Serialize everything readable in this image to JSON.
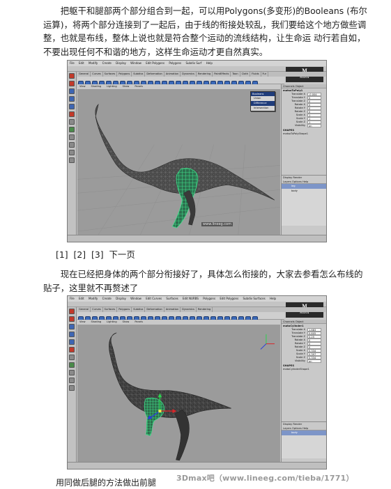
{
  "paragraph1": "把躯干和腿部两个部分组合到一起，可以用Polygons(多变形)的Booleans (布尔运算)，将两个部分连接到了一起后，由于线的衔接处较乱，我们要给这个地方做些调整，也就是布线，整体上说也就是符合整个运动的流线结构，让生命运 动行若自如，不要出现任何不和谐的地方，这样生命运动才更自然真实。",
  "pager": {
    "p1": "[1]",
    "p2": "[2]",
    "p3": "[3]",
    "next": "下一页"
  },
  "paragraph2": "现在已经把身体的两个部分衔接好了，具体怎么衔接的，大家去参看怎么布线的贴子，这里就不再赘述了",
  "caption": "用同做后腿的方法做出前腿",
  "watermark": "3Dmax吧（www.lineeg.com/tieba/1771）",
  "maya1": {
    "menubar": [
      "File",
      "Edit",
      "Modify",
      "Create",
      "Display",
      "Window",
      "Edit Polygons",
      "Polygons",
      "Subdiv Surf",
      "Help"
    ],
    "shelf_tabs": [
      "General",
      "Curves",
      "Surfaces",
      "Polygons",
      "Subdivs",
      "Deformation",
      "Animation",
      "Dynamics",
      "Rendering",
      "PaintEffects",
      "Toon",
      "Cloth",
      "Fluids",
      "Fur"
    ],
    "panel_menu": [
      "View",
      "Shading",
      "Lighting",
      "Show",
      "Panels"
    ],
    "boolean_menu": {
      "title": "Booleans",
      "options": [
        "Union",
        "Difference",
        "Intersection"
      ]
    },
    "channel": {
      "tabs": "Channels  Object",
      "object": "matsoTuPoly1",
      "rows": [
        {
          "label": "Translate X",
          "value": "-0.004"
        },
        {
          "label": "Translate Y",
          "value": "0"
        },
        {
          "label": "Translate Z",
          "value": "0"
        },
        {
          "label": "Rotate X",
          "value": "0"
        },
        {
          "label": "Rotate Y",
          "value": "0"
        },
        {
          "label": "Rotate Z",
          "value": "0"
        },
        {
          "label": "Scale X",
          "value": "1"
        },
        {
          "label": "Scale Y",
          "value": "1"
        },
        {
          "label": "Scale Z",
          "value": "1"
        },
        {
          "label": "Visibility",
          "value": "on"
        }
      ],
      "shapes_title": "SHAPES",
      "shape": "matsoTuPolyShape1"
    },
    "layers": {
      "tabs": "Display  Render",
      "menu": "Layers  Options  Help",
      "items": [
        "leg",
        "body"
      ]
    },
    "viewport_watermark": "www.lineeg.com"
  },
  "maya2": {
    "menubar": [
      "File",
      "Edit",
      "Modify",
      "Create",
      "Display",
      "Window",
      "Edit Curves",
      "Surfaces",
      "Edit NURBS",
      "Polygons",
      "Edit Polygons",
      "Subdiv Surfaces",
      "Help"
    ],
    "shelf_tabs": [
      "General",
      "Curves",
      "Surfaces",
      "Polygons",
      "Subdivs",
      "Deformation",
      "Animation",
      "Dynamics",
      "Rendering"
    ],
    "panel_menu": [
      "View",
      "Shading",
      "Lighting",
      "Show",
      "Panels"
    ],
    "channel": {
      "tabs": "Channels  Object",
      "object": "matoCylinder1",
      "rows": [
        {
          "label": "Translate X",
          "value": "1.683"
        },
        {
          "label": "Translate Y",
          "value": "0.605"
        },
        {
          "label": "Translate Z",
          "value": "0.25"
        },
        {
          "label": "Rotate X",
          "value": "0"
        },
        {
          "label": "Rotate Y",
          "value": "0"
        },
        {
          "label": "Rotate Z",
          "value": "0"
        },
        {
          "label": "Scale X",
          "value": "0.334"
        },
        {
          "label": "Scale Y",
          "value": "0.397"
        },
        {
          "label": "Scale Z",
          "value": "0.334"
        },
        {
          "label": "Visibility",
          "value": "on"
        }
      ],
      "shapes_title": "SHAPES",
      "shape": "matoCylinderShape1"
    },
    "layers": {
      "tabs": "Display  Render",
      "menu": "Layers  Options  Help",
      "items": [
        "body"
      ]
    }
  },
  "colors": {
    "viewport_bg": "#9b9b9b",
    "mesh_dark": "#3a3a3a",
    "mesh_green": "#3fe08a",
    "selection_blue": "#1f3c7a"
  }
}
